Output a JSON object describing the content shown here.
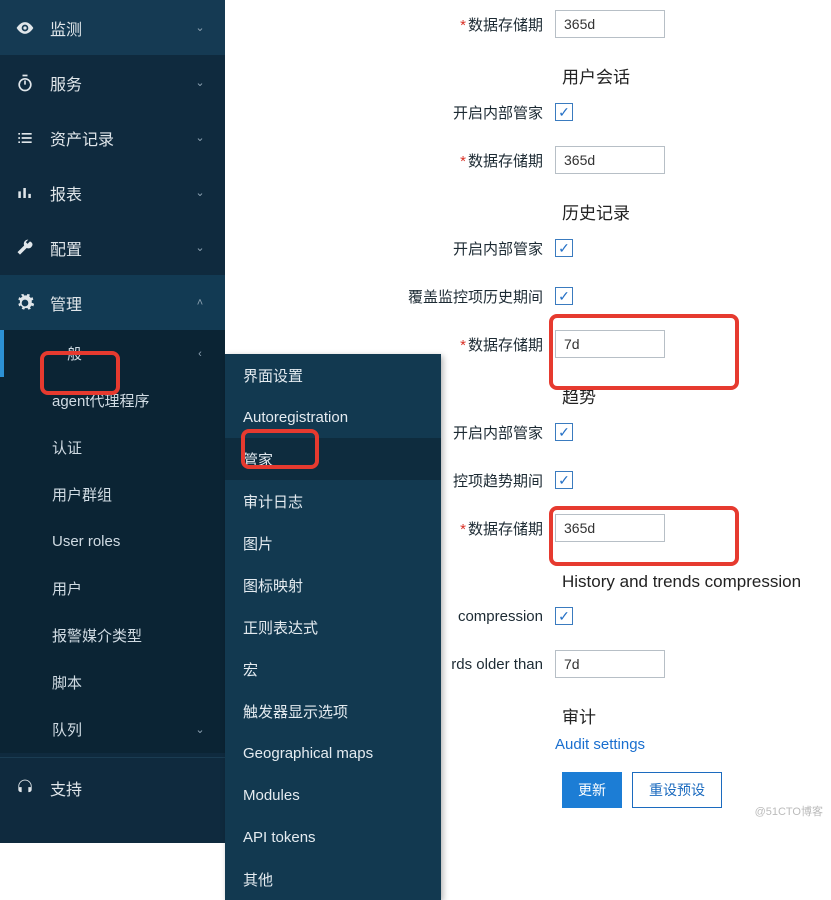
{
  "sidebar": {
    "items": [
      {
        "label": "监测"
      },
      {
        "label": "服务"
      },
      {
        "label": "资产记录"
      },
      {
        "label": "报表"
      },
      {
        "label": "配置"
      },
      {
        "label": "管理"
      }
    ],
    "admin_sub": [
      {
        "label": "一般"
      },
      {
        "label": "agent代理程序"
      },
      {
        "label": "认证"
      },
      {
        "label": "用户群组"
      },
      {
        "label": "User roles"
      },
      {
        "label": "用户"
      },
      {
        "label": "报警媒介类型"
      },
      {
        "label": "脚本"
      },
      {
        "label": "队列"
      }
    ],
    "support": {
      "label": "支持"
    }
  },
  "flyout": {
    "items": [
      {
        "label": "界面设置"
      },
      {
        "label": "Autoregistration"
      },
      {
        "label": "管家"
      },
      {
        "label": "审计日志"
      },
      {
        "label": "图片"
      },
      {
        "label": "图标映射"
      },
      {
        "label": "正则表达式"
      },
      {
        "label": "宏"
      },
      {
        "label": "触发器显示选项"
      },
      {
        "label": "Geographical maps"
      },
      {
        "label": "Modules"
      },
      {
        "label": "API tokens"
      },
      {
        "label": "其他"
      }
    ]
  },
  "form": {
    "storage_label": "数据存储期",
    "storage1_value": "365d",
    "sec_sessions": "用户会话",
    "enable_hk_label": "开启内部管家",
    "storage2_value": "365d",
    "sec_history": "历史记录",
    "override_history_label": "覆盖监控项历史期间",
    "storage3_value": "7d",
    "sec_trends": "趋势",
    "override_trends_label": "控项趋势期间",
    "storage4_value": "365d",
    "sec_compress": "History and trends compression",
    "compress_label": "compression",
    "older_label": "rds older than",
    "older_value": "7d",
    "sec_audit": "审计",
    "audit_link": "Audit settings",
    "btn_update": "更新",
    "btn_reset": "重设预设"
  },
  "watermark": "@51CTO博客"
}
